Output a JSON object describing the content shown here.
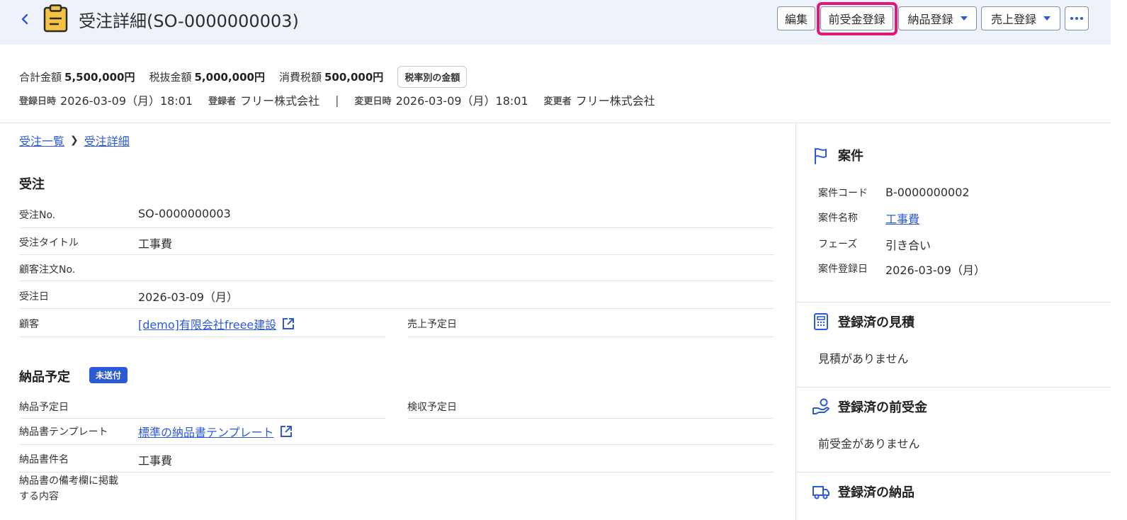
{
  "header": {
    "title": "受注詳細(SO-0000000003)",
    "buttons": {
      "edit": "編集",
      "advance_payment": "前受金登録",
      "delivery": "納品登録",
      "sales": "売上登録"
    }
  },
  "summary": {
    "total_label": "合計金額",
    "total_value": "5,500,000円",
    "pretax_label": "税抜金額",
    "pretax_value": "5,000,000円",
    "tax_label": "消費税額",
    "tax_value": "500,000円",
    "tax_rate_button": "税率別の金額",
    "created_at_label": "登録日時",
    "created_at": "2026-03-09（月）18:01",
    "created_by_label": "登録者",
    "created_by": "フリー株式会社",
    "separator": "|",
    "updated_at_label": "変更日時",
    "updated_at": "2026-03-09（月）18:01",
    "updated_by_label": "変更者",
    "updated_by": "フリー株式会社"
  },
  "breadcrumb": {
    "list": "受注一覧",
    "current": "受注詳細"
  },
  "order": {
    "heading": "受注",
    "no_label": "受注No.",
    "no_value": "SO-0000000003",
    "title_label": "受注タイトル",
    "title_value": "工事費",
    "customer_order_label": "顧客注文No.",
    "date_label": "受注日",
    "date_value": "2026-03-09（月）",
    "customer_label": "顧客",
    "customer_value": "[demo]有限会社freee建設",
    "sales_date_label": "売上予定日"
  },
  "delivery": {
    "heading": "納品予定",
    "badge": "未送付",
    "date_label": "納品予定日",
    "inspection_label": "検収予定日",
    "template_label": "納品書テンプレート",
    "template_value": "標準の納品書テンプレート",
    "doc_name_label": "納品書件名",
    "doc_name_value": "工事費",
    "remarks_label_1": "納品書の備考欄に掲載",
    "remarks_label_2": "する内容"
  },
  "side": {
    "project_title": "案件",
    "project_code_label": "案件コード",
    "project_code": "B-0000000002",
    "project_name_label": "案件名称",
    "project_name": "工事費",
    "phase_label": "フェーズ",
    "phase": "引き合い",
    "project_date_label": "案件登録日",
    "project_date": "2026-03-09（月）",
    "estimates_title": "登録済の見積",
    "estimates_empty": "見積がありません",
    "advance_title": "登録済の前受金",
    "advance_empty": "前受金がありません",
    "delivery_title": "登録済の納品"
  },
  "colors": {
    "accent": "#2c5ad6",
    "highlight": "#e2177a",
    "header_bg": "#eef2fb",
    "icon_yellow": "#f6c244"
  }
}
